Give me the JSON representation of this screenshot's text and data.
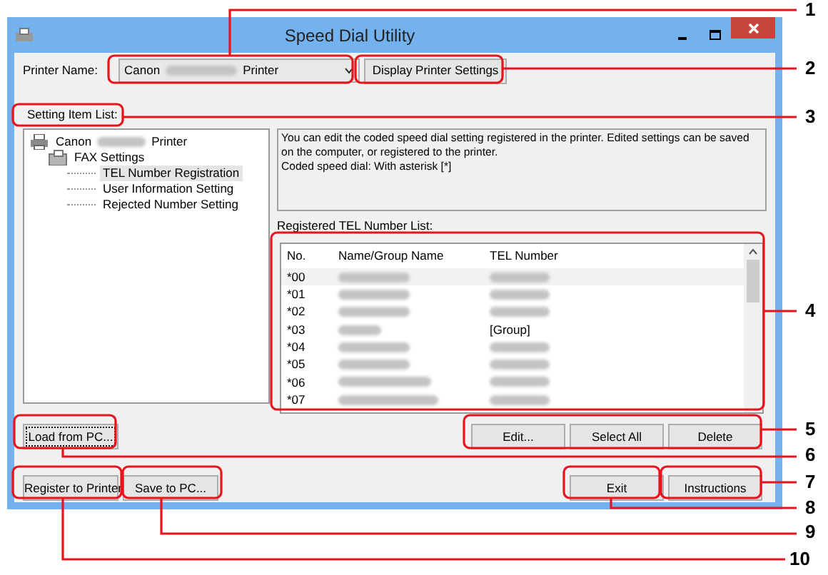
{
  "window": {
    "title": "Speed Dial Utility"
  },
  "printer": {
    "label": "Printer Name:",
    "value_start": "Canon",
    "value_end": "Printer",
    "button": "Display Printer Settings"
  },
  "setting_list": {
    "label": "Setting Item List:",
    "tree": [
      {
        "label_start": "Canon",
        "label_end": "Printer",
        "kind": "printer",
        "selected": false,
        "children": [
          {
            "label": "FAX Settings",
            "kind": "fax",
            "selected": false,
            "children": [
              {
                "label": "TEL Number Registration",
                "kind": "leaf",
                "selected": true
              },
              {
                "label": "User Information Setting",
                "kind": "leaf",
                "selected": false
              },
              {
                "label": "Rejected Number Setting",
                "kind": "leaf",
                "selected": false
              }
            ]
          }
        ]
      }
    ]
  },
  "info": [
    "You can edit the coded speed dial setting registered in the printer. Edited settings can be saved on the computer, or registered to the printer.",
    "Coded speed dial: With asterisk [*]"
  ],
  "tel_list": {
    "label": "Registered TEL Number List:",
    "columns": [
      "No.",
      "Name/Group Name",
      "TEL Number"
    ],
    "rows": [
      {
        "no": "*00",
        "selected": true
      },
      {
        "no": "*01",
        "selected": false
      },
      {
        "no": "*02",
        "selected": false
      },
      {
        "no": "*03",
        "tel": "[Group]",
        "selected": false
      },
      {
        "no": "*04",
        "selected": false
      },
      {
        "no": "*05",
        "selected": false
      },
      {
        "no": "*06",
        "selected": false
      },
      {
        "no": "*07",
        "selected": false
      }
    ]
  },
  "list_buttons": [
    "Edit...",
    "Select All",
    "Delete"
  ],
  "load_button": "Load from PC...",
  "bottom_left_buttons": [
    "Register to Printer",
    "Save to PC..."
  ],
  "bottom_right_buttons": [
    "Exit",
    "Instructions"
  ],
  "callouts": [
    "1",
    "2",
    "3",
    "4",
    "5",
    "6",
    "7",
    "8",
    "9",
    "10"
  ]
}
